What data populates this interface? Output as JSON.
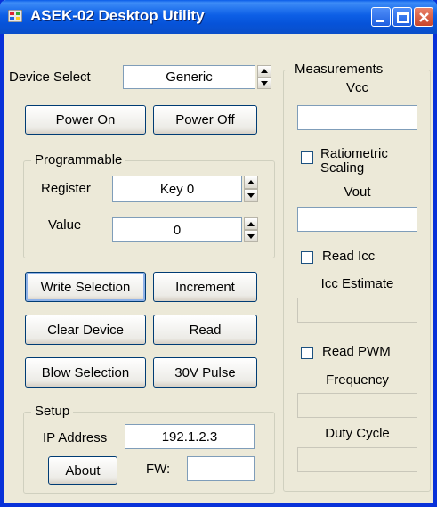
{
  "window": {
    "title": "ASEK-02 Desktop Utility"
  },
  "device": {
    "label": "Device Select",
    "value": "Generic"
  },
  "buttons": {
    "power_on": "Power On",
    "power_off": "Power Off",
    "write_selection": "Write Selection",
    "increment": "Increment",
    "clear_device": "Clear Device",
    "read": "Read",
    "blow_selection": "Blow Selection",
    "pulse_30v": "30V Pulse",
    "about": "About"
  },
  "programmable": {
    "title": "Programmable",
    "register_label": "Register",
    "register_value": "Key 0",
    "value_label": "Value",
    "value_value": "0"
  },
  "setup": {
    "title": "Setup",
    "ip_label": "IP Address",
    "ip_value": "192.1.2.3",
    "fw_label": "FW:",
    "fw_value": ""
  },
  "measurements": {
    "title": "Measurements",
    "vcc_label": "Vcc",
    "ratiometric_line1": "Ratiometric",
    "ratiometric_line2": "Scaling",
    "vout_label": "Vout",
    "read_icc_label": "Read Icc",
    "icc_estimate_label": "Icc Estimate",
    "read_pwm_label": "Read PWM",
    "frequency_label": "Frequency",
    "duty_cycle_label": "Duty Cycle"
  },
  "colors": {
    "titlebar": "#0a5ce8",
    "window_bg": "#ece9d8",
    "border": "#0831d9"
  }
}
